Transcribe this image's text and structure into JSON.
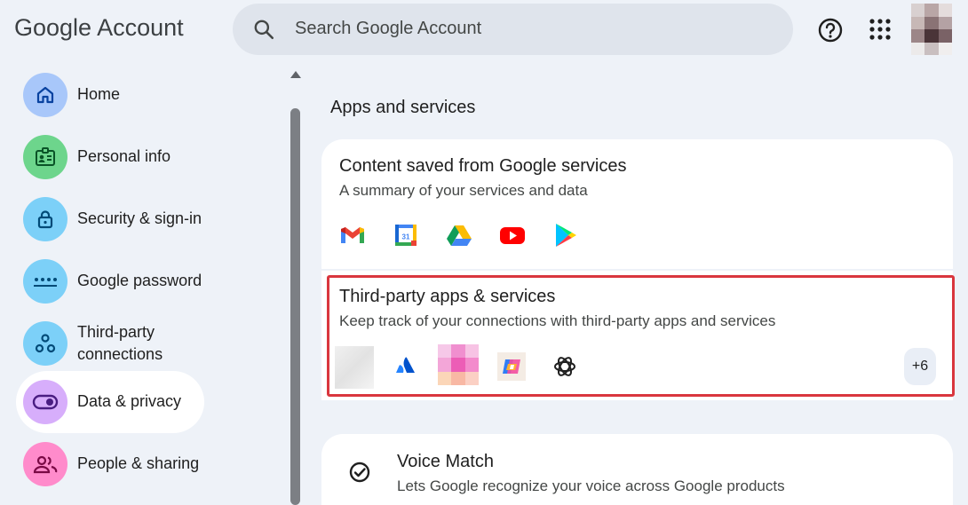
{
  "header": {
    "logo_google": "Google",
    "logo_account": "Account",
    "search_placeholder": "Search Google Account"
  },
  "sidebar": {
    "items": [
      {
        "label": "Home",
        "icon": "home-icon",
        "color": "#a8c7fa"
      },
      {
        "label": "Personal info",
        "icon": "id-card-icon",
        "color": "#6dd58c"
      },
      {
        "label": "Security & sign-in",
        "icon": "lock-icon",
        "color": "#7cd0f8"
      },
      {
        "label": "Google password",
        "icon": "password-icon",
        "color": "#7cd0f8"
      },
      {
        "label": "Third-party connections",
        "icon": "connections-icon",
        "color": "#7cd0f8"
      },
      {
        "label": "Data & privacy",
        "icon": "toggle-icon",
        "color": "#d7aefb",
        "active": true
      },
      {
        "label": "People & sharing",
        "icon": "people-icon",
        "color": "#ff8bcb"
      }
    ]
  },
  "main": {
    "section_title": "Apps and services",
    "card_google": {
      "title": "Content saved from Google services",
      "subtitle": "A summary of your services and data",
      "services": [
        "gmail-icon",
        "calendar-icon",
        "drive-icon",
        "youtube-icon",
        "play-icon"
      ],
      "calendar_day": "31"
    },
    "card_third_party": {
      "title": "Third-party apps & services",
      "subtitle": "Keep track of your connections with third-party apps and services",
      "apps": [
        "blurred-app-icon",
        "atlassian-icon",
        "pixelated-app-icon",
        "copilot-icon",
        "openai-icon"
      ],
      "more_count": "+6"
    },
    "card_voice": {
      "title": "Voice Match",
      "subtitle": "Lets Google recognize your voice across Google products",
      "icon": "voice-match-icon"
    }
  }
}
